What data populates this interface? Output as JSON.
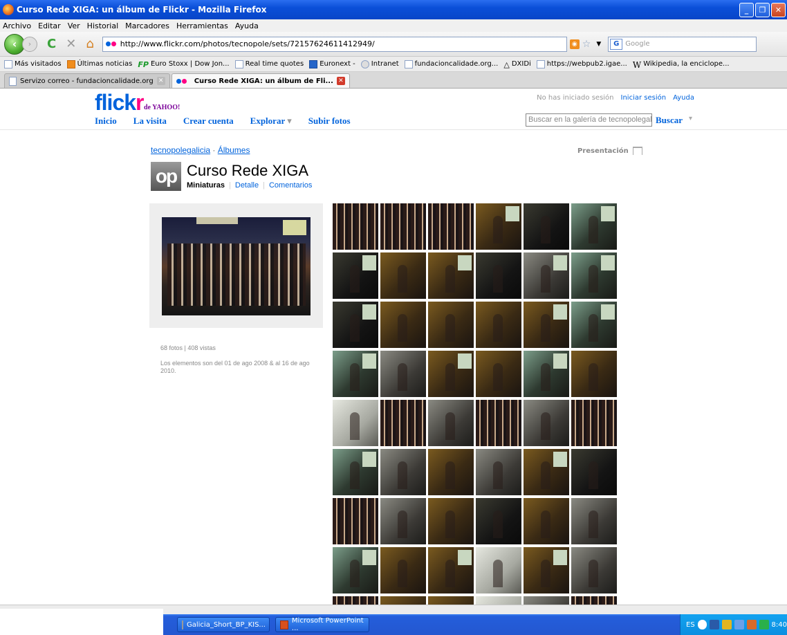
{
  "window": {
    "title": "Curso Rede XIGA: un álbum de Flickr - Mozilla Firefox"
  },
  "menu": [
    "Archivo",
    "Editar",
    "Ver",
    "Historial",
    "Marcadores",
    "Herramientas",
    "Ayuda"
  ],
  "navbar": {
    "url": "http://www.flickr.com/photos/tecnopole/sets/72157624611412949/",
    "search_placeholder": "Google"
  },
  "bookmarks": [
    {
      "label": "Más visitados",
      "icon": "page-icon"
    },
    {
      "label": "Últimas noticias",
      "icon": "rss-icon"
    },
    {
      "label": "Euro Stoxx | Dow Jon...",
      "icon": "fp-icon"
    },
    {
      "label": "Real time quotes",
      "icon": "page-icon"
    },
    {
      "label": "Euronext -",
      "icon": "euronext-icon"
    },
    {
      "label": "Intranet",
      "icon": "intranet-icon"
    },
    {
      "label": "fundacioncalidade.org...",
      "icon": "page-icon"
    },
    {
      "label": "DXIDi",
      "icon": "dxidi-icon"
    },
    {
      "label": "https://webpub2.igae...",
      "icon": "page-icon"
    },
    {
      "label": "Wikipedia, la enciclope...",
      "icon": "wikipedia-icon"
    }
  ],
  "tabs": [
    {
      "label": "Servizo correo - fundacioncalidade.org",
      "active": false
    },
    {
      "label": "Curso Rede XIGA: un álbum de Fli...",
      "active": true
    }
  ],
  "flickr": {
    "logo_text": "flickr",
    "logo_suffix": "de YAHOO!",
    "nav": [
      "Inicio",
      "La visita",
      "Crear cuenta",
      "Explorar",
      "Subir fotos"
    ],
    "session_status": "No has iniciado sesión",
    "login_link": "Iniciar sesión",
    "help_link": "Ayuda",
    "gallery_search_placeholder": "Buscar en la galería de tecnopolegalicia",
    "search_button": "Buscar",
    "breadcrumb_user": "tecnopolegalicia",
    "breadcrumb_sep": "·",
    "breadcrumb_albums": "Álbumes",
    "presentation": "Presentación",
    "buddy_text": "op",
    "set_title": "Curso Rede XIGA",
    "view_current": "Miniaturas",
    "view_detail": "Detalle",
    "view_comments": "Comentarios",
    "stats": "68 fotos | 408 vistas",
    "dates": "Los elementos son del 01 de ago 2008 & al 16 de ago 2010."
  },
  "taskbar": {
    "items": [
      "Galicia_Short_BP_KIS...",
      "Microsoft PowerPoint ..."
    ],
    "lang": "ES",
    "clock": "8:40"
  }
}
